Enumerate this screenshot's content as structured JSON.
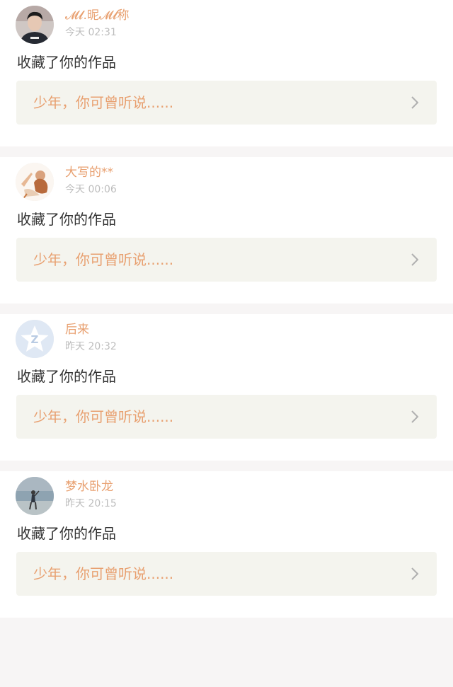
{
  "notifications": [
    {
      "username": "𝓜𝓵.昵𝓜𝓵称",
      "time": "今天 02:31",
      "action": "收藏了你的作品",
      "work_title": "少年，你可曾听说......",
      "avatar_icon": "person-avatar"
    },
    {
      "username": "大写的**",
      "time": "今天 00:06",
      "action": "收藏了你的作品",
      "work_title": "少年，你可曾听说......",
      "avatar_icon": "illustrated-avatar"
    },
    {
      "username": "后来",
      "time": "昨天 20:32",
      "action": "收藏了你的作品",
      "work_title": "少年，你可曾听说......",
      "avatar_icon": "default-qzone-avatar"
    },
    {
      "username": "梦水卧龙",
      "time": "昨天 20:15",
      "action": "收藏了你的作品",
      "work_title": "少年，你可曾听说......",
      "avatar_icon": "beach-photo-avatar"
    }
  ],
  "colors": {
    "accent": "#e8a070",
    "page_background": "#f7f5f5",
    "card_background": "#ffffff",
    "link_background": "#f4f4ee",
    "time_text": "#bdbdbd",
    "body_text": "#333333"
  }
}
